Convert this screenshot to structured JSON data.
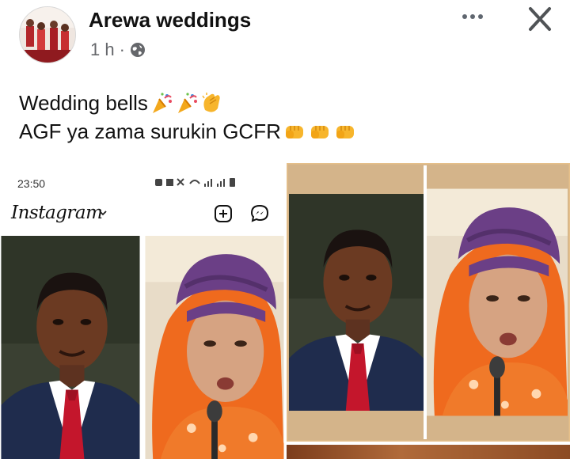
{
  "post": {
    "page_name": "Arewa weddings",
    "time": "1 h",
    "separator": "·",
    "caption_line1": "Wedding bells",
    "caption_line2": "AGF ya zama surukin GCFR",
    "caption_line1_emojis": [
      "party-popper",
      "party-popper",
      "clapping-hands"
    ],
    "caption_line2_emojis": [
      "fist-bump",
      "fist-bump",
      "fist-bump"
    ]
  },
  "embedded_screenshot": {
    "status_time": "23:50",
    "app_name": "Instagram",
    "icons": [
      "plus-square-icon",
      "messenger-icon",
      "chevron-down-icon"
    ]
  },
  "colors": {
    "meta_gray": "#65676b",
    "headscarf_orange": "#ef6a1e",
    "turban_purple": "#6b3f86",
    "suit_navy": "#1f2c4d",
    "tie_red": "#c4162c"
  }
}
